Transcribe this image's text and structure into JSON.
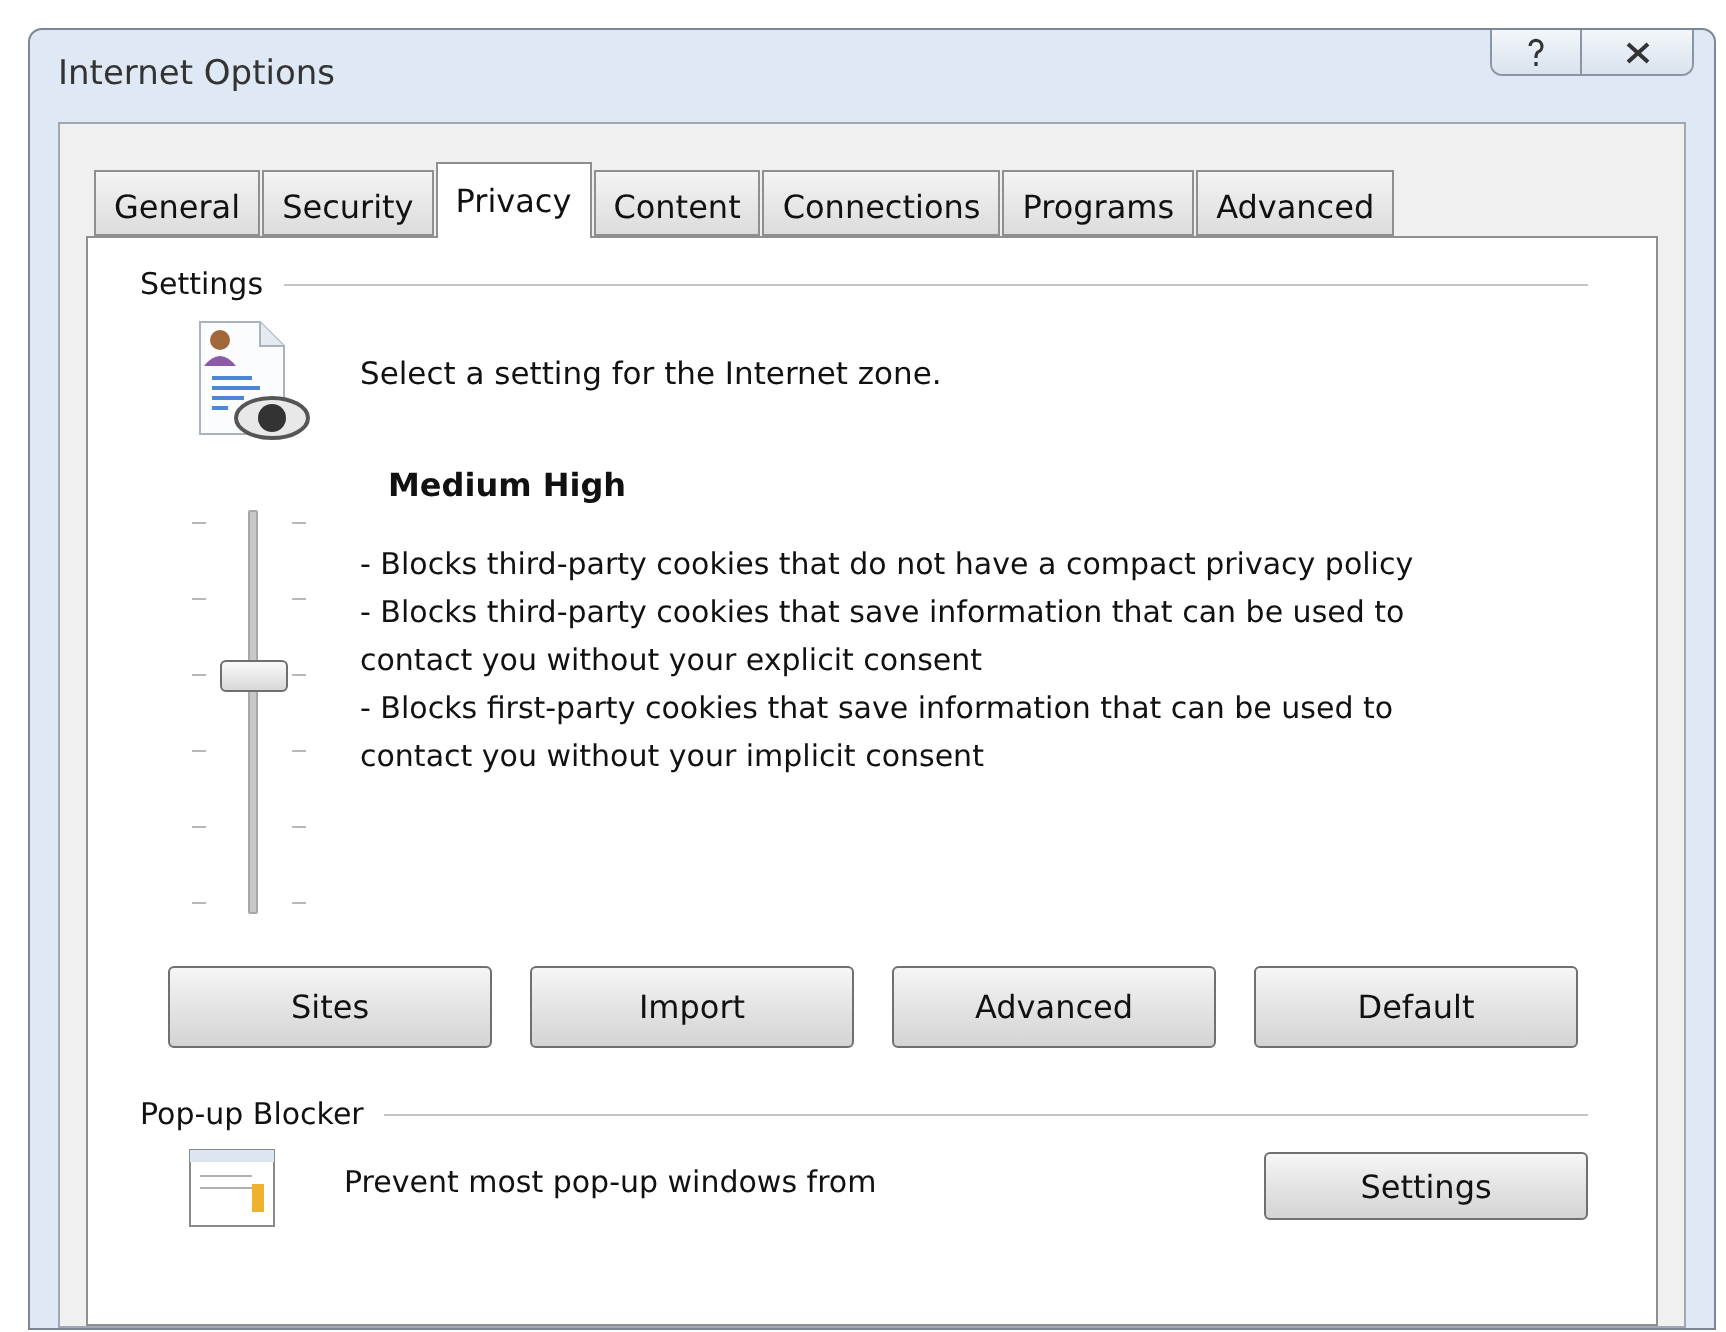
{
  "window": {
    "title": "Internet Options"
  },
  "tabs": [
    {
      "label": "General",
      "selected": false
    },
    {
      "label": "Security",
      "selected": false
    },
    {
      "label": "Privacy",
      "selected": true
    },
    {
      "label": "Content",
      "selected": false
    },
    {
      "label": "Connections",
      "selected": false
    },
    {
      "label": "Programs",
      "selected": false
    },
    {
      "label": "Advanced",
      "selected": false
    }
  ],
  "settings": {
    "heading": "Settings",
    "intro": "Select a setting for the Internet zone.",
    "slider": {
      "level": 0.6
    },
    "level_name": "Medium High",
    "description": [
      "- Blocks third-party cookies that do not have a compact privacy policy",
      "- Blocks third-party cookies that save information that can be used to contact you without your explicit consent",
      "- Blocks first-party cookies that save information that can be used to contact you without your implicit consent"
    ],
    "buttons": [
      "Sites",
      "Import",
      "Advanced",
      "Default"
    ]
  },
  "popup_blocker": {
    "heading": "Pop-up Blocker",
    "text": "Prevent most pop-up windows from",
    "button": "Settings"
  }
}
